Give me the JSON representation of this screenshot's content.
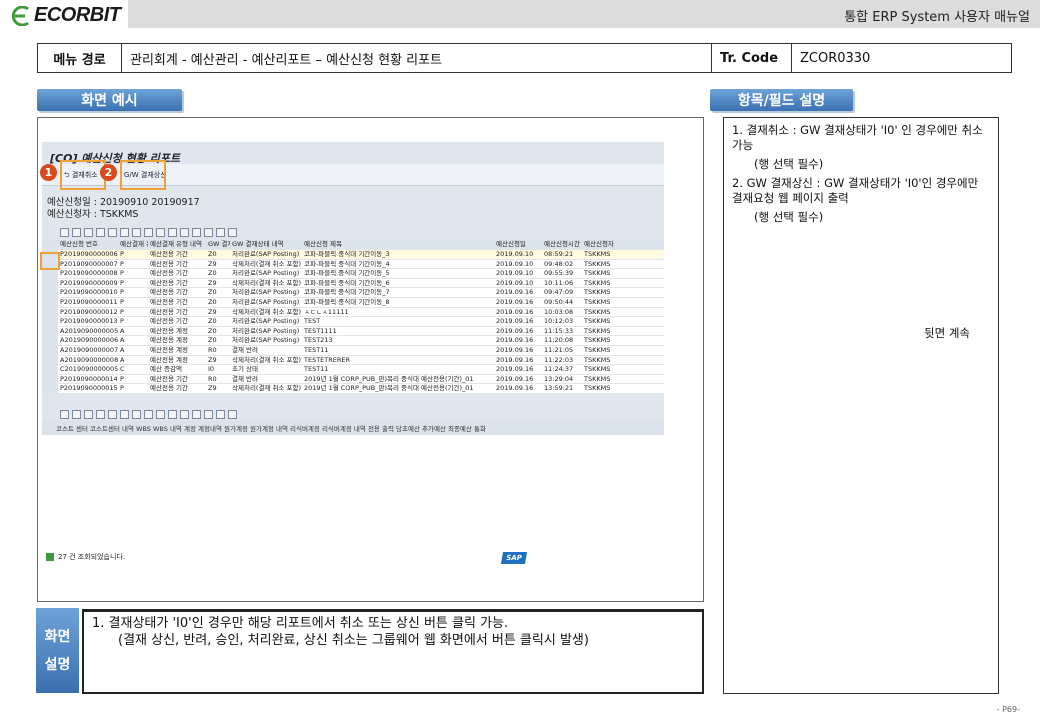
{
  "header": {
    "logo": "ECORBIT",
    "doc_title": "통합 ERP System 사용자 매뉴얼"
  },
  "menu": {
    "label": "메뉴 경로",
    "path": "관리회계 - 예산관리 - 예산리포트 – 예산신청 현황 리포트",
    "tr_label": "Tr. Code",
    "tr_code": "ZCOR0330"
  },
  "sections": {
    "screen_example": "화면 예시",
    "field_desc": "항목/필드 설명",
    "screen_desc": "화면 설명"
  },
  "sap": {
    "title": "[CO] 예산신청 현황 리포트",
    "btn1": "결재취소",
    "btn2": "G/W 결재상신",
    "badge1": "1",
    "badge2": "2",
    "info1": "예산신청일 : 20190910 20190917",
    "info2": "예산신청자 : TSKKMS",
    "columns": [
      "예산신청 번호",
      "예산결재 유형",
      "예산결재 유형 내역",
      "GW 결재상태",
      "GW 결재상태 내역",
      "예산신청 제목",
      "예산신청일",
      "예산신청시간",
      "예산신청자"
    ],
    "rows": [
      [
        "P2019090000006",
        "P",
        "예산전용 기간",
        "Z0",
        "처리완료(SAP Posting)",
        "코파-파블릭 중식대 기간이동_3",
        "2019.09.10",
        "08:59:21",
        "TSKKMS"
      ],
      [
        "P2019090000007",
        "P",
        "예산전용 기간",
        "Z9",
        "삭제처리(결재 취소 포함)",
        "코파-파블릭 중식대 기간이동_4",
        "2019.09.10",
        "09:48:02",
        "TSKKMS"
      ],
      [
        "P2019090000008",
        "P",
        "예산전용 기간",
        "Z0",
        "처리완료(SAP Posting)",
        "코파-파블릭 중식대 기간이동_5",
        "2019.09.10",
        "09:55:39",
        "TSKKMS"
      ],
      [
        "P2019090000009",
        "P",
        "예산전용 기간",
        "Z9",
        "삭제처리(결재 취소 포함)",
        "코파-파블릭 중식대 기간이동_6",
        "2019.09.10",
        "10:11:06",
        "TSKKMS"
      ],
      [
        "P2019090000010",
        "P",
        "예산전용 기간",
        "Z0",
        "처리완료(SAP Posting)",
        "코파-파블릭 중식대 기간이동_7",
        "2019.09.16",
        "09:47:09",
        "TSKKMS"
      ],
      [
        "P2019090000011",
        "P",
        "예산전용 기간",
        "Z0",
        "처리완료(SAP Posting)",
        "코파-파블릭 중식대 기간이동_8",
        "2019.09.16",
        "09:50:44",
        "TSKKMS"
      ],
      [
        "P2019090000012",
        "P",
        "예산전용 기간",
        "Z9",
        "삭제처리(결재 취소 포함)",
        "ㅅㄷㄴㅅ11111",
        "2019.09.16",
        "10:03:08",
        "TSKKMS"
      ],
      [
        "P2019090000013",
        "P",
        "예산전용 기간",
        "Z0",
        "처리완료(SAP Posting)",
        "TEST",
        "2019.09.16",
        "10:12:03",
        "TSKKMS"
      ],
      [
        "A2019090000005",
        "A",
        "예산전용 계정",
        "Z0",
        "처리완료(SAP Posting)",
        "TEST1111",
        "2019.09.16",
        "11:15:33",
        "TSKKMS"
      ],
      [
        "A2019090000006",
        "A",
        "예산전용 계정",
        "Z0",
        "처리완료(SAP Posting)",
        "TEST213",
        "2019.09.16",
        "11:20:08",
        "TSKKMS"
      ],
      [
        "A2019090000007",
        "A",
        "예산전용 계정",
        "R0",
        "결재 반려",
        "TEST11",
        "2019.09.16",
        "11:21:05",
        "TSKKMS"
      ],
      [
        "A2019090000008",
        "A",
        "예산전용 계정",
        "Z9",
        "삭제처리(결재 취소 포함)",
        "TESTETRERER",
        "2019.09.16",
        "11:22:03",
        "TSKKMS"
      ],
      [
        "C2019090000005",
        "C",
        "예산 증감액",
        "I0",
        "초기 상태",
        "TEST11",
        "2019.09.16",
        "11:24:37",
        "TSKKMS"
      ],
      [
        "P2019090000014",
        "P",
        "예산전용 기간",
        "R0",
        "결재 반려",
        "2019년 1월 CORP_PUB_판)복리 중식대 예산전용(기간)_01",
        "2019.09.16",
        "13:29:04",
        "TSKKMS"
      ],
      [
        "P2019090000015",
        "P",
        "예산전용 기간",
        "Z9",
        "삭제처리(결재 취소 포함)",
        "2019년 1월 CORP_PUB_판)복리 중식대 예산전용(기간)_01",
        "2019.09.16",
        "13:59:21",
        "TSKKMS"
      ]
    ],
    "detail_columns": "코스트 센터 코스트센터 내역 WBS WBS 내역 계정 계정내역 원가계정 원가계정 내역 리식버계정 리식버계정 내역 전용 출력 당초예산 추가예산 최종예산 통화",
    "status": "27 건 조회되었습니다.",
    "sap_logo": "SAP"
  },
  "right": {
    "item1_a": "1.   결재취소  :  GW  결재상태가  'I0' 인 경우에만 취소 가능",
    "item1_b": "(행 선택 필수)",
    "item2_a": "2.    GW  결재상신 : GW 결재상태가 'I0'인 경우에만 결재요청 웹 페이지 출력",
    "item2_b": "(행 선택 필수)",
    "cont": "뒷면 계속"
  },
  "desc": {
    "line1": "1.   결재상태가 'I0'인 경우만 해당 리포트에서 취소 또는 상신 버튼 클릭 가능.",
    "line2": "(결재 상신, 반려, 승인, 처리완료, 상신 취소는 그룹웨어 웹 화면에서 버튼 클릭시 발생)"
  },
  "page_no": "- P69-"
}
